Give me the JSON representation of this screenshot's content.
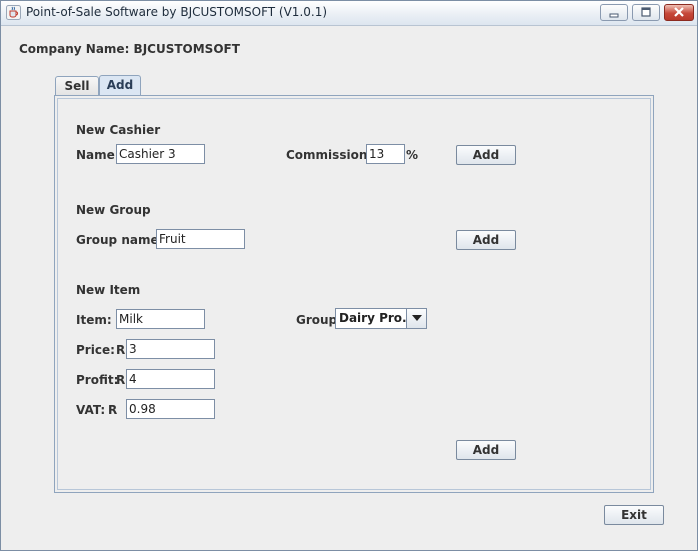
{
  "window": {
    "title": "Point-of-Sale Software by BJCUSTOMSOFT   (V1.0.1)",
    "controls": {
      "minimize": "minimize",
      "maximize": "maximize",
      "close": "close"
    }
  },
  "company": {
    "label": "Company Name: BJCUSTOMSOFT"
  },
  "tabs": [
    {
      "label": "Sell",
      "active": false
    },
    {
      "label": "Add",
      "active": true
    }
  ],
  "new_cashier": {
    "heading": "New Cashier",
    "name_label": "Name:",
    "name_value": "Cashier 3",
    "commission_label": "Commission:",
    "commission_value": "13",
    "commission_unit": "%",
    "add_label": "Add"
  },
  "new_group": {
    "heading": "New Group",
    "group_name_label": "Group name:",
    "group_name_value": "Fruit",
    "add_label": "Add"
  },
  "new_item": {
    "heading": "New Item",
    "item_label": "Item:",
    "item_value": "Milk",
    "group_label": "Group:",
    "group_selected": "Dairy Pro...",
    "price_label": "Price:",
    "price_currency": "R",
    "price_value": "3",
    "profit_label": "Profit:",
    "profit_currency": "R",
    "profit_value": "4",
    "vat_label": "VAT:",
    "vat_currency": "R",
    "vat_value": "0.98",
    "add_label": "Add"
  },
  "footer": {
    "exit_label": "Exit"
  }
}
